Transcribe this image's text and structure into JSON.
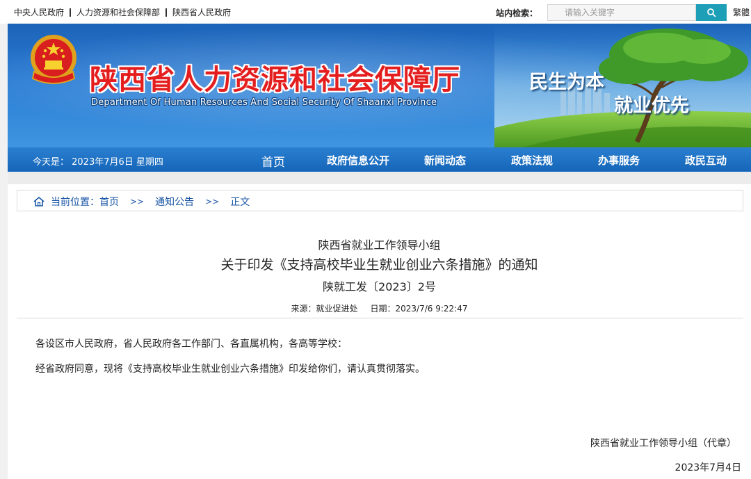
{
  "top_links": [
    "中央人民政府",
    "人力资源和社会保障部",
    "陕西省人民政府"
  ],
  "search": {
    "label": "站内检索：",
    "placeholder": "请输入关键字",
    "button_icon": "search-icon"
  },
  "language_link": "繁體",
  "banner": {
    "title": "陕西省人力资源和社会保障厅",
    "subtitle": "Department Of Human Resources And Social Security Of Shaanxi Province",
    "slogan_line1": "民生为本",
    "slogan_line2": "就业优先",
    "emblem_icon": "national-emblem-icon"
  },
  "nav": {
    "today": "今天是：  2023年7月6日  星期四",
    "items": [
      "首页",
      "政府信息公开",
      "新闻动态",
      "政策法规",
      "办事服务",
      "政民互动"
    ]
  },
  "breadcrumb": {
    "label": "当前位置：",
    "items": [
      "首页",
      "通知公告",
      "正文"
    ],
    "separator": ">>"
  },
  "document": {
    "issuer": "陕西省就业工作领导小组",
    "title": "关于印发《支持高校毕业生就业创业六条措施》的通知",
    "number": "陕就工发〔2023〕2号",
    "source": "来源：就业促进处",
    "date": "日期：2023/7/6 9:22:47",
    "paragraphs": [
      "各设区市人民政府，省人民政府各工作部门、各直属机构，各高等学校：",
      "经省政府同意，现将《支持高校毕业生就业创业六条措施》印发给你们，请认真贯彻落实。"
    ],
    "signature": "陕西省就业工作领导小组（代章）",
    "signed_date": "2023年7月4日"
  },
  "colors": {
    "nav_blue": "#1565b8",
    "title_red": "#e41e1e",
    "search_button": "#1e9fb8",
    "link_blue": "#1a56a6"
  }
}
